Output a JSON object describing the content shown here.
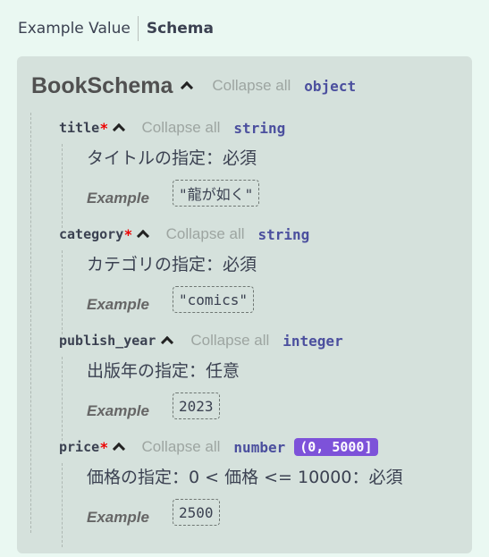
{
  "tabs": {
    "example_label": "Example Value",
    "schema_label": "Schema"
  },
  "schema": {
    "name": "BookSchema",
    "collapse_label": "Collapse all",
    "type": "object",
    "properties": [
      {
        "name": "title",
        "required_mark": "*",
        "collapse_label": "Collapse all",
        "type": "string",
        "range": "",
        "description": "タイトルの指定：必須",
        "example_label": "Example",
        "example": "\"龍が如く\""
      },
      {
        "name": "category",
        "required_mark": "*",
        "collapse_label": "Collapse all",
        "type": "string",
        "range": "",
        "description": "カテゴリの指定：必須",
        "example_label": "Example",
        "example": "\"comics\""
      },
      {
        "name": "publish_year",
        "required_mark": "",
        "collapse_label": "Collapse all",
        "type": "integer",
        "range": "",
        "description": "出版年の指定：任意",
        "example_label": "Example",
        "example": "2023"
      },
      {
        "name": "price",
        "required_mark": "*",
        "collapse_label": "Collapse all",
        "type": "number",
        "range": "(0, 5000]",
        "description": "価格の指定：0 < 価格 <= 10000：必須",
        "example_label": "Example",
        "example": "2500"
      }
    ]
  },
  "colors": {
    "background": "#eaf8f2",
    "panel": "#d5e1dc",
    "required": "#ee0000",
    "type": "#4b4f9e",
    "range_badge": "#7d52d9"
  }
}
